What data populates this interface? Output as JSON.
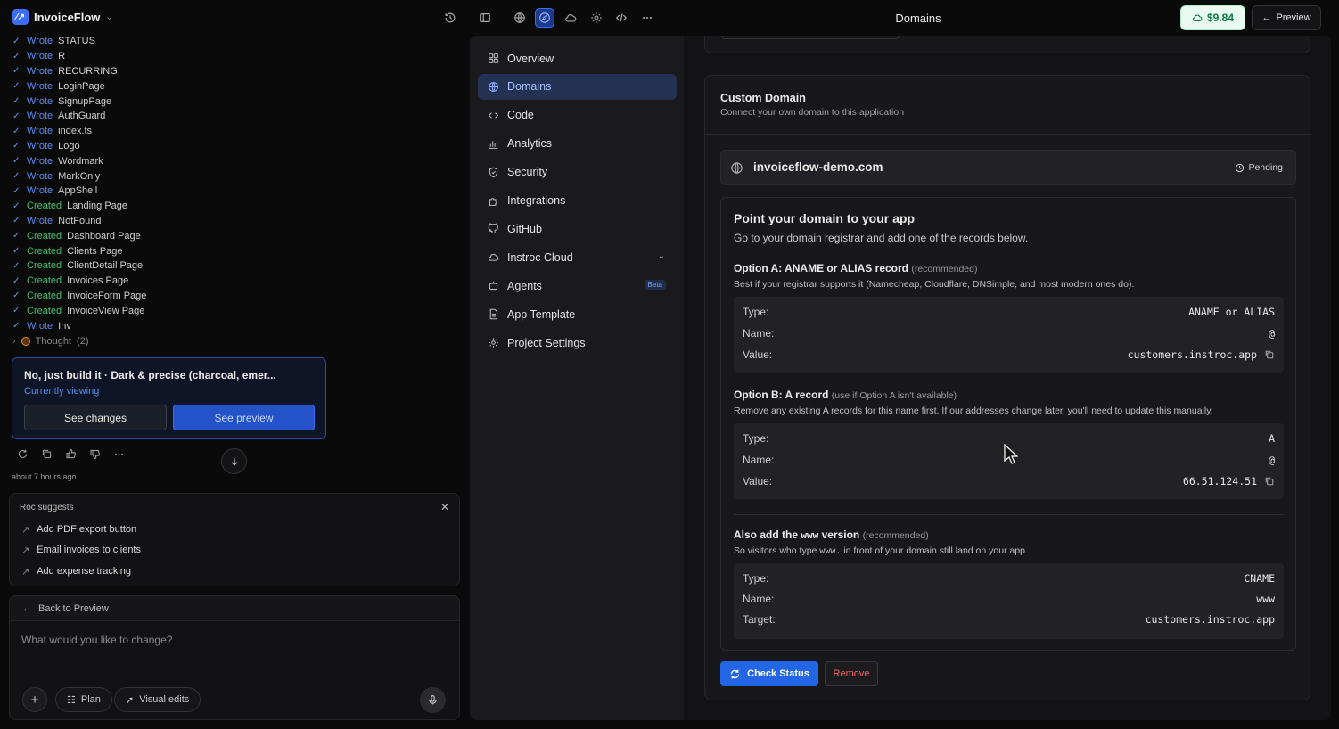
{
  "app": {
    "name": "InvoiceFlow",
    "logo_icon": "invoiceflow-logo-icon"
  },
  "header": {
    "title": "Domains",
    "credits": "$9.84",
    "preview_label": "Preview",
    "toolbar_icons": [
      "history-icon",
      "sidebar-toggle-icon",
      "globe-icon",
      "compass-icon",
      "cloud-icon",
      "gear-icon",
      "code-icon",
      "more-icon"
    ]
  },
  "log": [
    {
      "verb": "Wrote",
      "target": "STATUS"
    },
    {
      "verb": "Wrote",
      "target": "R"
    },
    {
      "verb": "Wrote",
      "target": "RECURRING"
    },
    {
      "verb": "Wrote",
      "target": "LoginPage"
    },
    {
      "verb": "Wrote",
      "target": "SignupPage"
    },
    {
      "verb": "Wrote",
      "target": "AuthGuard"
    },
    {
      "verb": "Wrote",
      "target": "index.ts"
    },
    {
      "verb": "Wrote",
      "target": "Logo"
    },
    {
      "verb": "Wrote",
      "target": "Wordmark"
    },
    {
      "verb": "Wrote",
      "target": "MarkOnly"
    },
    {
      "verb": "Wrote",
      "target": "AppShell"
    },
    {
      "verb": "Created",
      "target": "Landing Page"
    },
    {
      "verb": "Wrote",
      "target": "NotFound"
    },
    {
      "verb": "Created",
      "target": "Dashboard Page"
    },
    {
      "verb": "Created",
      "target": "Clients Page"
    },
    {
      "verb": "Created",
      "target": "ClientDetail Page"
    },
    {
      "verb": "Created",
      "target": "Invoices Page"
    },
    {
      "verb": "Created",
      "target": "InvoiceForm Page"
    },
    {
      "verb": "Created",
      "target": "InvoiceView Page"
    },
    {
      "verb": "Wrote",
      "target": "Inv"
    }
  ],
  "thought": {
    "label": "Thought",
    "count": "(2)"
  },
  "card": {
    "title": "No, just build it · Dark & precise (charcoal, emer...",
    "subtitle": "Currently viewing",
    "changes_label": "See changes",
    "preview_label": "See preview"
  },
  "timestamp": "about 7 hours ago",
  "suggestions": {
    "title": "Roc suggests",
    "items": [
      "Add PDF export button",
      "Email invoices to clients",
      "Add expense tracking"
    ]
  },
  "composer": {
    "back_label": "Back to Preview",
    "placeholder": "What would you like to change?",
    "plan_label": "Plan",
    "visual_label": "Visual edits"
  },
  "nav": {
    "items": [
      {
        "label": "Overview",
        "icon": "overview-icon"
      },
      {
        "label": "Domains",
        "icon": "globe-icon",
        "active": true
      },
      {
        "label": "Code",
        "icon": "code-icon"
      },
      {
        "label": "Analytics",
        "icon": "analytics-icon"
      },
      {
        "label": "Security",
        "icon": "shield-icon"
      },
      {
        "label": "Integrations",
        "icon": "puzzle-icon"
      },
      {
        "label": "GitHub",
        "icon": "github-icon"
      },
      {
        "label": "Instroc Cloud",
        "icon": "cloud-icon"
      },
      {
        "label": "Agents",
        "icon": "agent-icon",
        "badge": "Beta"
      },
      {
        "label": "App Template",
        "icon": "template-icon"
      },
      {
        "label": "Project Settings",
        "icon": "gear-icon"
      }
    ]
  },
  "domain": {
    "title": "Custom Domain",
    "subtitle": "Connect your own domain to this application",
    "name": "invoiceflow-demo.com",
    "status": "Pending",
    "heading": "Point your domain to your app",
    "heading_sub": "Go to your domain registrar and add one of the records below.",
    "option_a": {
      "title": "Option A: ANAME or ALIAS record",
      "note": "(recommended)",
      "desc": "Best if your registrar supports it (Namecheap, Cloudflare, DNSimple, and most modern ones do).",
      "rows": [
        {
          "k": "Type:",
          "v": "ANAME or ALIAS"
        },
        {
          "k": "Name:",
          "v": "@"
        },
        {
          "k": "Value:",
          "v": "customers.instroc.app"
        }
      ]
    },
    "option_b": {
      "title": "Option B: A record",
      "note": "(use if Option A isn't available)",
      "desc": "Remove any existing A records for this name first. If our addresses change later, you'll need to update this manually.",
      "rows": [
        {
          "k": "Type:",
          "v": "A"
        },
        {
          "k": "Name:",
          "v": "@"
        },
        {
          "k": "Value:",
          "v": "66.51.124.51"
        }
      ]
    },
    "www": {
      "title_pre": "Also add the",
      "title_code": "www",
      "title_post": "version",
      "note": "(recommended)",
      "desc_pre": "So visitors who type",
      "desc_code": "www.",
      "desc_post": "in front of your domain still land on your app.",
      "rows": [
        {
          "k": "Type:",
          "v": "CNAME"
        },
        {
          "k": "Name:",
          "v": "www"
        },
        {
          "k": "Target:",
          "v": "customers.instroc.app"
        }
      ]
    },
    "check_label": "Check Status",
    "remove_label": "Remove"
  }
}
